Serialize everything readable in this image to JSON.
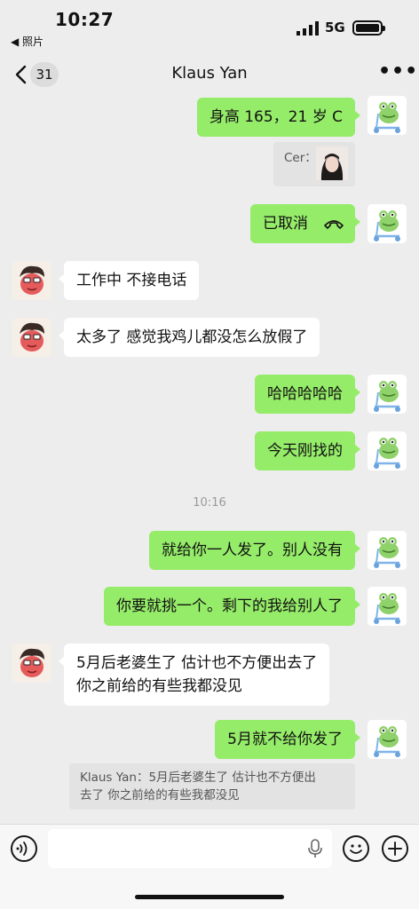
{
  "status_bar": {
    "time": "10:27",
    "back_app": "◀ 照片",
    "network": "5G"
  },
  "nav": {
    "unread_count": "31",
    "title": "Klaus Yan"
  },
  "messages": [
    {
      "side": "me",
      "text": "身高 165，21 岁 C"
    },
    {
      "side": "me",
      "type": "quote-image",
      "quote_label": "Cer："
    },
    {
      "side": "me",
      "type": "call",
      "text": "已取消"
    },
    {
      "side": "them",
      "text": "工作中 不接电话"
    },
    {
      "side": "them",
      "text": "太多了 感觉我鸡儿都没怎么放假了"
    },
    {
      "side": "me",
      "text": "哈哈哈哈哈"
    },
    {
      "side": "me",
      "text": "今天刚找的"
    },
    {
      "type": "time",
      "text": "10:16"
    },
    {
      "side": "me",
      "text": "就给你一人发了。别人没有"
    },
    {
      "side": "me",
      "text": "你要就挑一个。剩下的我给别人了"
    },
    {
      "side": "them",
      "text_line1": "5月后老婆生了 估计也不方便出去了",
      "text_line2": "你之前给的有些我都没见"
    },
    {
      "side": "me",
      "text": "5月就不给你发了"
    },
    {
      "type": "quote",
      "line1": "Klaus Yan：5月后老婆生了 估计也不方便出",
      "line2": "去了 你之前给的有些我都没见"
    }
  ],
  "colors": {
    "my_bubble": "#95ec69",
    "their_bubble": "#ffffff",
    "background": "#ededed"
  }
}
